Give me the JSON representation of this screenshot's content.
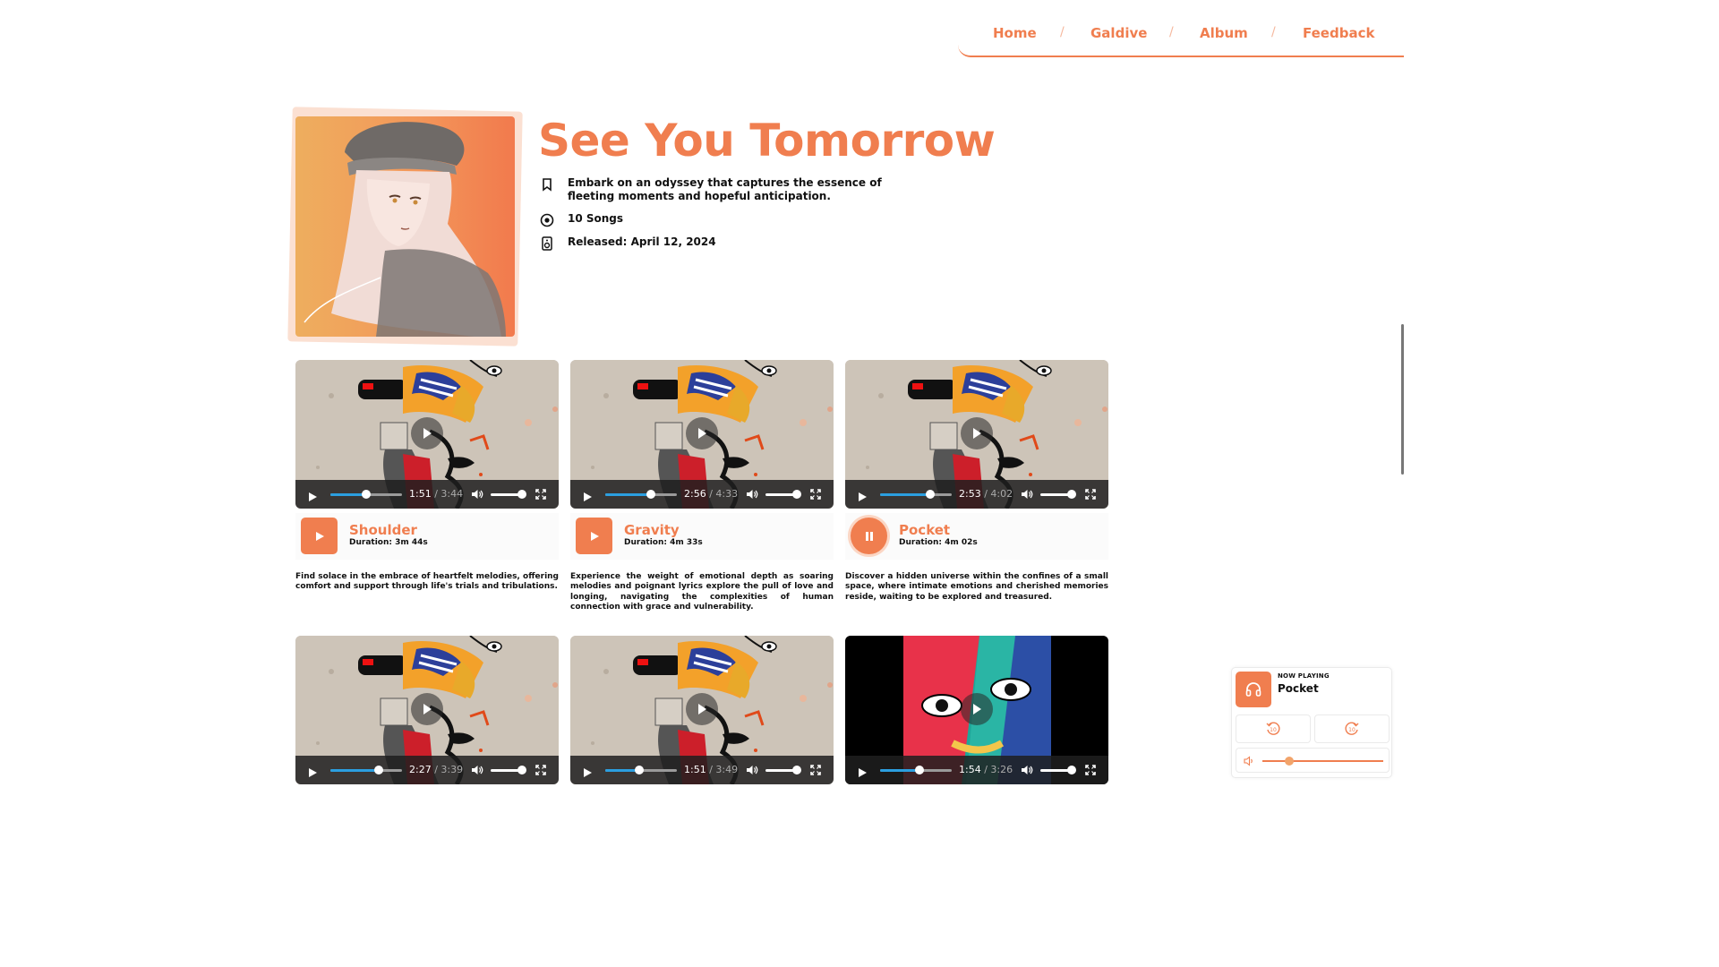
{
  "nav": {
    "items": [
      "Home",
      "Galdive",
      "Album",
      "Feedback"
    ],
    "separator": "/"
  },
  "album": {
    "title": "See You Tomorrow",
    "description": "Embark on an odyssey that captures the essence of fleeting moments and hopeful anticipation.",
    "songs_count": "10 Songs",
    "released": "Released: April 12, 2024",
    "accent_color": "#f07e4f"
  },
  "tracks": [
    {
      "name": "Shoulder",
      "duration": "Duration: 3m 44s",
      "current_time": "1:51",
      "total_time": "3:44",
      "progress": 0.5,
      "description": "Find solace in the embrace of heartfelt melodies, offering comfort and support through life's trials and tribulations.",
      "playing": false
    },
    {
      "name": "Gravity",
      "duration": "Duration: 4m 33s",
      "current_time": "2:56",
      "total_time": "4:33",
      "progress": 0.64,
      "description": "Experience the weight of emotional depth as soaring melodies and poignant lyrics explore the pull of love and longing, navigating the complexities of human connection with grace and vulnerability.",
      "playing": false
    },
    {
      "name": "Pocket",
      "duration": "Duration: 4m 02s",
      "current_time": "2:53",
      "total_time": "4:02",
      "progress": 0.7,
      "description": "Discover a hidden universe within the confines of a small space, where intimate emotions and cherished memories reside, waiting to be explored and treasured.",
      "playing": true
    },
    {
      "name": "",
      "current_time": "2:27",
      "total_time": "3:39",
      "progress": 0.67
    },
    {
      "name": "",
      "current_time": "1:51",
      "total_time": "3:49",
      "progress": 0.48
    },
    {
      "name": "",
      "current_time": "1:54",
      "total_time": "3:26",
      "progress": 0.55
    }
  ],
  "now_playing": {
    "label": "NOW PLAYING",
    "title": "Pocket",
    "rewind_label": "10",
    "forward_label": "10",
    "volume": 0.22
  },
  "icons": {
    "description": "bookmark-icon",
    "songs": "disc-icon",
    "released": "speaker-icon",
    "now_playing": "headphones-icon"
  }
}
